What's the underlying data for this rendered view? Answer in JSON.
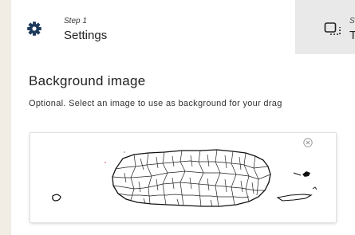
{
  "steps": [
    {
      "number": "Step 1",
      "title": "Settings",
      "icon": "gear-icon"
    },
    {
      "number": "S",
      "title": "T",
      "icon": "layers-icon"
    }
  ],
  "section": {
    "title": "Background image",
    "description": "Optional. Select an image to use as background for your drag"
  },
  "image": {
    "alt": "map-image",
    "remove_icon": "close-circle-icon"
  },
  "colors": {
    "page_bg": "#f1ede4",
    "inactive_step_bg": "#e9e9e9",
    "icon": "#1d3a5c"
  }
}
